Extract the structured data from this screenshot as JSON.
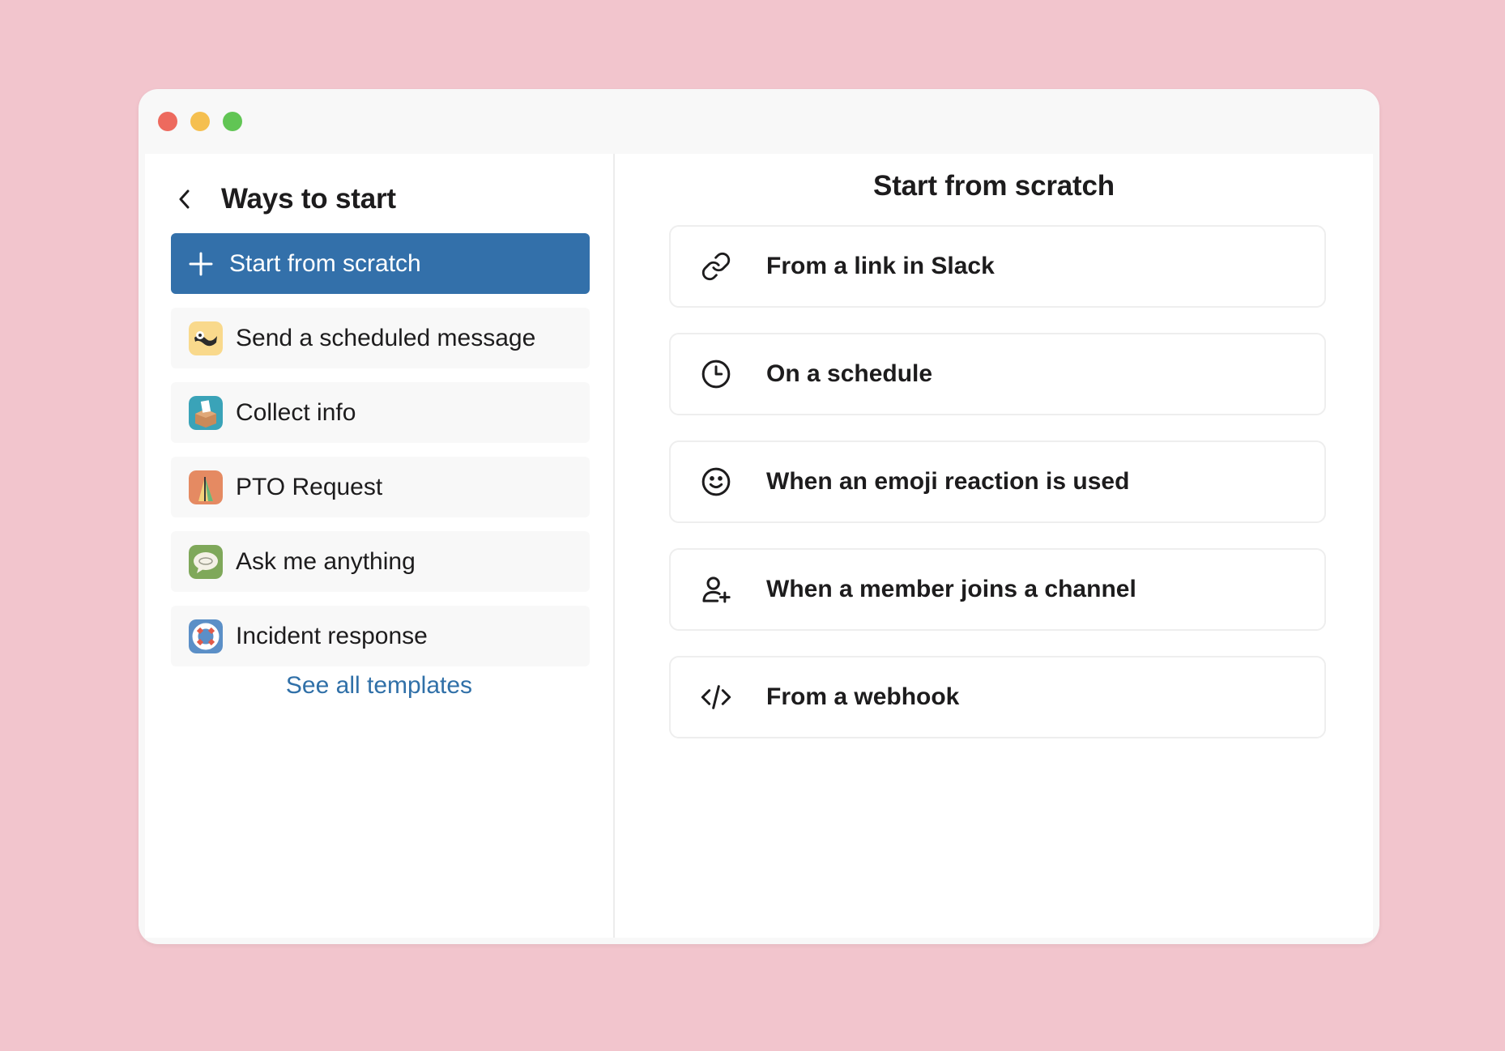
{
  "window": {
    "traffic_lights": [
      "close",
      "minimize",
      "zoom"
    ]
  },
  "left_panel": {
    "title": "Ways to start",
    "back_icon": "chevron-left-icon",
    "items": [
      {
        "label": "Start from scratch",
        "icon": "plus-icon",
        "selected": true
      },
      {
        "label": "Send a scheduled message",
        "icon": "scheduled-message-icon",
        "selected": false
      },
      {
        "label": "Collect info",
        "icon": "collect-info-icon",
        "selected": false
      },
      {
        "label": "PTO Request",
        "icon": "pto-request-icon",
        "selected": false
      },
      {
        "label": "Ask me anything",
        "icon": "ask-me-anything-icon",
        "selected": false
      },
      {
        "label": "Incident response",
        "icon": "incident-response-icon",
        "selected": false
      }
    ],
    "see_all_label": "See all templates"
  },
  "right_panel": {
    "title": "Start from scratch",
    "triggers": [
      {
        "label": "From a link in Slack",
        "icon": "link-icon"
      },
      {
        "label": "On a schedule",
        "icon": "clock-icon"
      },
      {
        "label": "When an emoji reaction is used",
        "icon": "smiley-icon"
      },
      {
        "label": "When a member joins a channel",
        "icon": "user-add-icon"
      },
      {
        "label": "From a webhook",
        "icon": "code-icon"
      }
    ]
  },
  "colors": {
    "background": "#f2c5cd",
    "selected": "#3370aa",
    "link": "#3070a8",
    "close": "#ed6a5e",
    "minimize": "#f5bf4f",
    "zoom": "#61c554"
  }
}
